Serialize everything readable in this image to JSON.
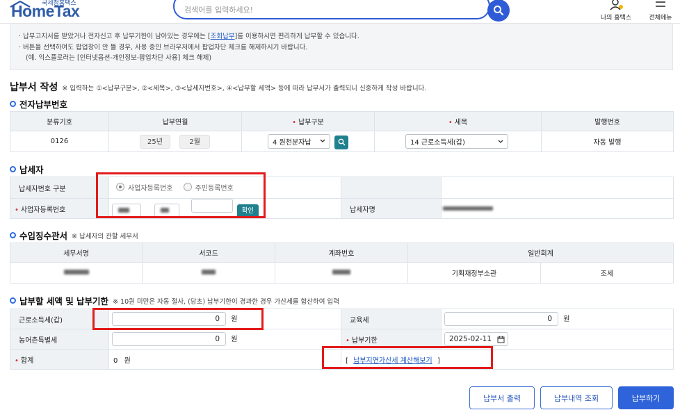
{
  "header": {
    "logo_subtitle": "국세청홈택스",
    "logo_text": "HomeTax",
    "search_placeholder": "검색어를 입력하세요!",
    "my_hometax": "나의 홈택스",
    "all_menu": "전체메뉴"
  },
  "notice": {
    "line1": "· 납부고지서를 받았거나 전자신고 후 납부기한이 남아있는 경우에는 [",
    "line1_link": "조회납부",
    "line1_tail": "]를 이용하시면 편리하게  납부할 수 있습니다.",
    "line2": "· 버튼을 선택하여도 팝업창이 안 뜰 경우, 사용 중인 브라우저에서 팝업차단 체크를 해제하시기 바랍니다.",
    "line3": "(예. 익스플로러는 [인터넷옵션-개인정보-팝업차단 사용] 체크 해제)"
  },
  "page_title": {
    "title": "납부서 작성",
    "note": "※ 입력하는 ①<납부구분>, ②<세목>, ③<납세자번호>, ④<납부할 세액> 등에 따라 납부서가 출력되니 신중하게 작성 바랍니다."
  },
  "payment_number": {
    "section": "전자납부번호",
    "headers": [
      "분류기호",
      "납부연월",
      "납부구분",
      "세목",
      "발행번호"
    ],
    "classification": "0126",
    "year": "25년",
    "month": "2월",
    "payment_type": "4 원천분자납",
    "tax_item": "14 근로소득세(갑)",
    "issue_number": "자동 발행"
  },
  "taxpayer": {
    "section": "납세자",
    "id_type_label": "납세자번호 구분",
    "option_business": "사업자등록번호",
    "option_resident": "주민등록번호",
    "business_number_label": "사업자등록번호",
    "confirm_button": "확인",
    "name_label": "납세자명"
  },
  "collection_office": {
    "section": "수입징수관서",
    "note": "※ 납세자의 관할 세무서",
    "headers": [
      "세무서명",
      "서코드",
      "계좌번호",
      "일반회계"
    ],
    "general_account_1": "기획재정부소관",
    "general_account_2": "조세"
  },
  "tax_amount": {
    "section": "납부할 세액 및 납부기한",
    "note": "※ 10원 미만은 자동 절사, (당초) 납부기한이 경과한 경우 가산세를 합산하여 입력",
    "earned_income_label": "근로소득세(갑)",
    "earned_income_value": "0",
    "rural_tax_label": "농어촌특별세",
    "rural_tax_value": "0",
    "total_label": "합계",
    "total_value": "0",
    "unit": "원",
    "education_tax_label": "교육세",
    "education_tax_value": "0",
    "due_date_label": "납부기한",
    "due_date_value": "2025-02-11",
    "late_fee_link": "납부지연가산세 계산해보기"
  },
  "buttons": {
    "print": "납부서 출력",
    "history": "납부내역 조회",
    "pay": "납부하기"
  },
  "colors": {
    "primary_blue": "#2f63d9",
    "teal": "#21808d",
    "highlight_red": "#e31b1b",
    "required": "#e0282e"
  }
}
